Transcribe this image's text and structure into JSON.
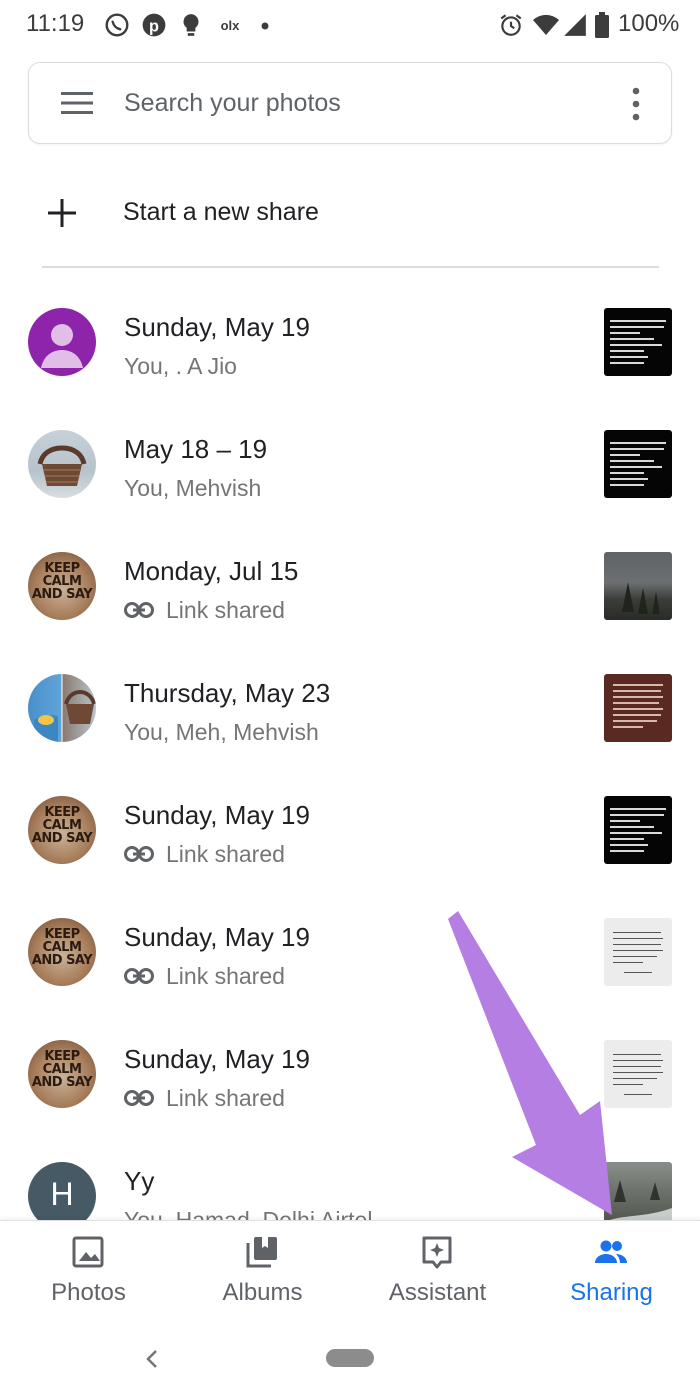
{
  "status_bar": {
    "time": "11:19",
    "left_icons": [
      "whatsapp-icon",
      "pinterest-icon",
      "lightbulb-icon",
      "olx-icon",
      "dot-icon"
    ],
    "right_icons": [
      "alarm-icon",
      "wifi-icon",
      "signal-icon",
      "battery-icon"
    ],
    "battery": "100%"
  },
  "search": {
    "placeholder": "Search your photos"
  },
  "new_share": {
    "label": "Start a new share"
  },
  "shares": [
    {
      "title": "Sunday, May 19",
      "subtitle": "You, . A Jio",
      "link_shared": false,
      "avatar": "person-placeholder",
      "thumbnail": "text-meme-black"
    },
    {
      "title": "May 18 – 19",
      "subtitle": "You, Mehvish",
      "link_shared": false,
      "avatar": "basket-photo",
      "thumbnail": "text-meme-black"
    },
    {
      "title": "Monday, Jul 15",
      "subtitle": "Link shared",
      "link_shared": true,
      "avatar": "keep-calm-photo",
      "thumbnail": "forest-photo"
    },
    {
      "title": "Thursday, May 23",
      "subtitle": "You, Meh, Mehvish",
      "link_shared": false,
      "avatar": "split-photo",
      "thumbnail": "quote-red"
    },
    {
      "title": "Sunday, May 19",
      "subtitle": "Link shared",
      "link_shared": true,
      "avatar": "keep-calm-photo",
      "thumbnail": "text-meme-black"
    },
    {
      "title": "Sunday, May 19",
      "subtitle": "Link shared",
      "link_shared": true,
      "avatar": "keep-calm-photo",
      "thumbnail": "quote-grey"
    },
    {
      "title": "Sunday, May 19",
      "subtitle": "Link shared",
      "link_shared": true,
      "avatar": "keep-calm-photo",
      "thumbnail": "quote-grey"
    },
    {
      "title": "Yy",
      "subtitle": "You, Hamad, Delhi Airtel",
      "link_shared": false,
      "avatar": "letter-H",
      "avatar_letter": "H",
      "thumbnail": "road-photo"
    }
  ],
  "avatar_text": {
    "keep_calm": "KEEP CALM AND SAY"
  },
  "bottom_nav": {
    "items": [
      {
        "label": "Photos",
        "icon": "photo-icon",
        "active": false
      },
      {
        "label": "Albums",
        "icon": "albums-icon",
        "active": false
      },
      {
        "label": "Assistant",
        "icon": "assistant-icon",
        "active": false
      },
      {
        "label": "Sharing",
        "icon": "people-icon",
        "active": true
      }
    ]
  },
  "colors": {
    "accent": "#1a73e8",
    "annotation_arrow": "#b57ee3",
    "avatar_purple": "#8e24aa",
    "avatar_slate": "#455a64"
  }
}
